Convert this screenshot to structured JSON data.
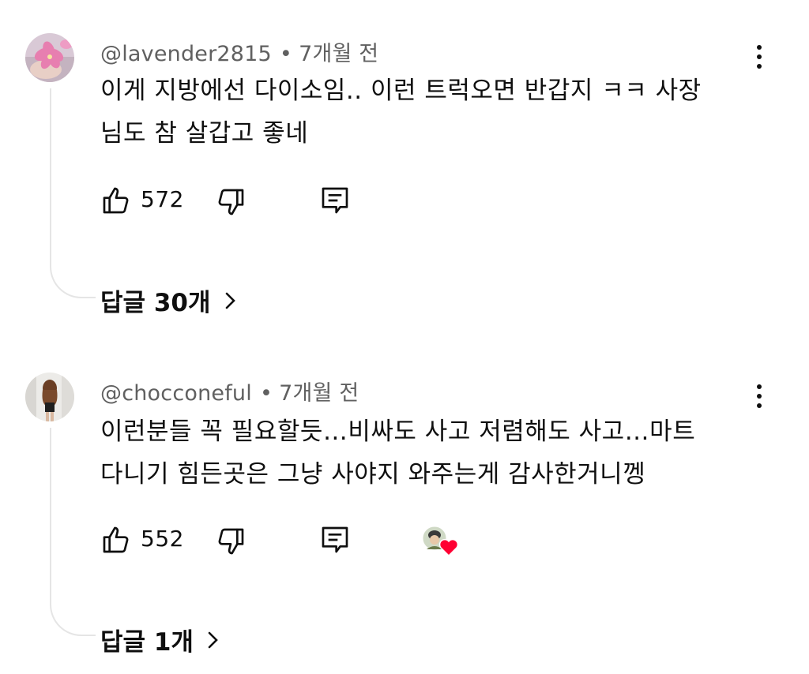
{
  "comments": [
    {
      "author": "@lavender2815",
      "separator": "•",
      "time": "7개월 전",
      "text_lines": [
        "이게 지방에선 다이소임.. 이런 트럭오면 반갑지 ㅋㅋ 사장",
        "님도 참 살갑고 좋네"
      ],
      "likes": "572",
      "replies_label": "답글 30개",
      "avatar_icon": "pink-flower-photo",
      "creator_heart": false
    },
    {
      "author": "@chocconeful",
      "separator": "•",
      "time": "7개월 전",
      "text_lines": [
        "이런분들 꼭 필요할듯…비싸도 사고 저렴해도 사고…마트",
        "다니기 힘든곳은 그냥 사야지 와주는게 감사한거니껭"
      ],
      "likes": "552",
      "replies_label": "답글 1개",
      "avatar_icon": "woman-back-photo",
      "creator_heart": true
    }
  ],
  "colors": {
    "text": "#0f0f0f",
    "meta": "#606060",
    "thread_line": "#e5e5e5",
    "heart": "#ff0033"
  },
  "icons": {
    "like": "thumbs-up-icon",
    "dislike": "thumbs-down-icon",
    "reply": "comment-reply-icon",
    "more": "more-vertical-icon",
    "chevron": "chevron-right-icon"
  }
}
